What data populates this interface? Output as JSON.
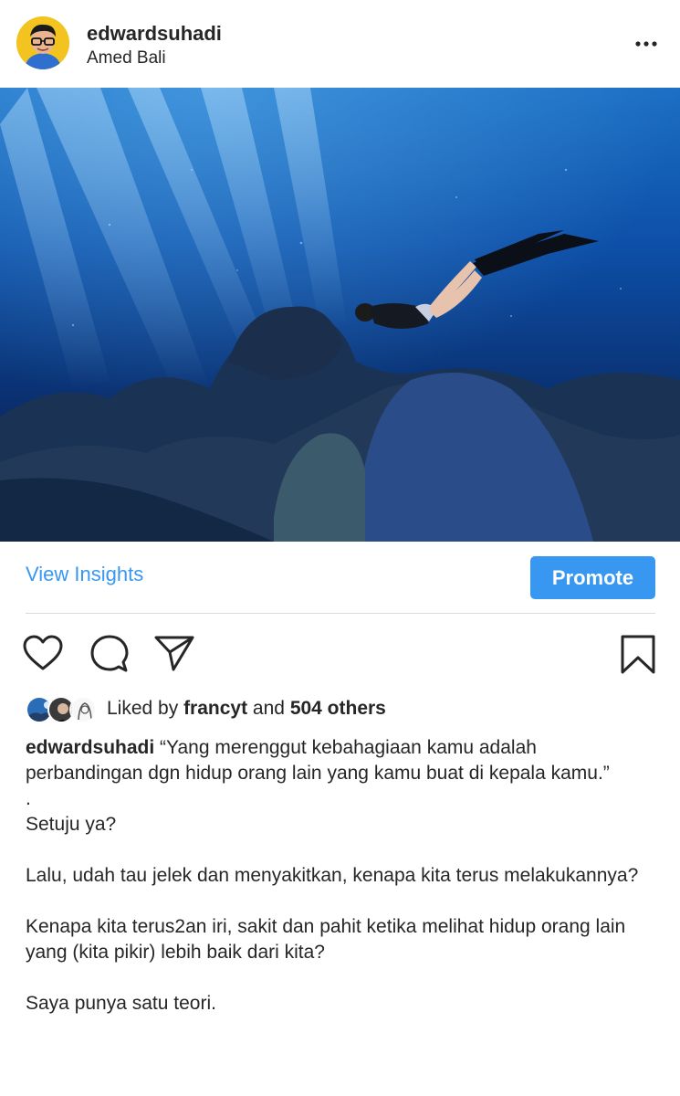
{
  "post": {
    "username": "edwardsuhadi",
    "location": "Amed Bali",
    "more_icon": "more-horizontal-icon"
  },
  "insights": {
    "view_insights_label": "View Insights",
    "promote_label": "Promote"
  },
  "actions": {
    "like_icon": "heart-icon",
    "comment_icon": "comment-icon",
    "share_icon": "send-icon",
    "save_icon": "bookmark-icon"
  },
  "likes": {
    "prefix": "Liked by ",
    "user": "francyt",
    "middle": " and ",
    "count": "504 others"
  },
  "caption": {
    "username": "edwardsuhadi",
    "first": " “Yang merenggut kebahagiaan kamu adalah perbandingan dgn hidup orang lain yang kamu buat di kepala kamu.”",
    "dot": ".",
    "line2": "Setuju ya?",
    "line3": "Lalu, udah tau jelek dan menyakitkan, kenapa kita terus melakukannya?",
    "line4": "Kenapa kita terus2an iri, sakit dan pahit ketika melihat hidup orang lain yang (kita pikir) lebih baik dari kita?",
    "line5": "Saya punya satu teori."
  },
  "colors": {
    "accent": "#3897f0",
    "text": "#262626",
    "divider": "#dbdbdb"
  }
}
